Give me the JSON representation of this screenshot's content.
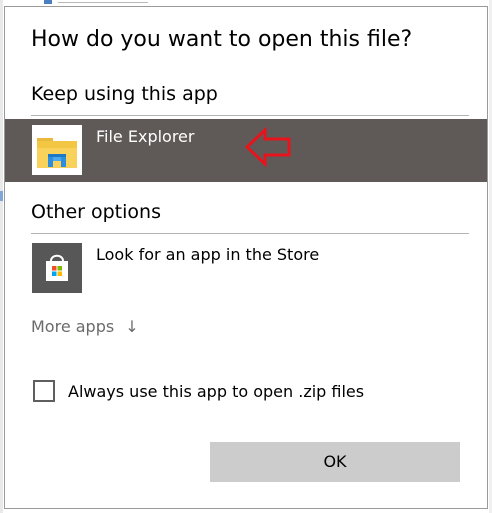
{
  "dialog": {
    "title": "How do you want to open this file?",
    "keep_using_heading": "Keep using this app",
    "other_options_heading": "Other options",
    "more_apps_label": "More apps",
    "more_apps_icon": "arrow-down-icon",
    "always_use_label": "Always use this app to open .zip files",
    "always_use_checked": false,
    "ok_label": "OK"
  },
  "apps": {
    "current": {
      "name": "File Explorer",
      "icon": "file-explorer-icon",
      "selected": true
    },
    "options": [
      {
        "name": "Look for an app in the Store",
        "icon": "store-icon"
      }
    ]
  },
  "annotation": {
    "icon": "red-arrow-icon",
    "color": "#e8141c"
  },
  "colors": {
    "selected_row_bg": "#5f5a57",
    "ok_button_bg": "#cccccc",
    "divider": "#b3b3b3",
    "more_apps_text": "#6b6b6b"
  }
}
